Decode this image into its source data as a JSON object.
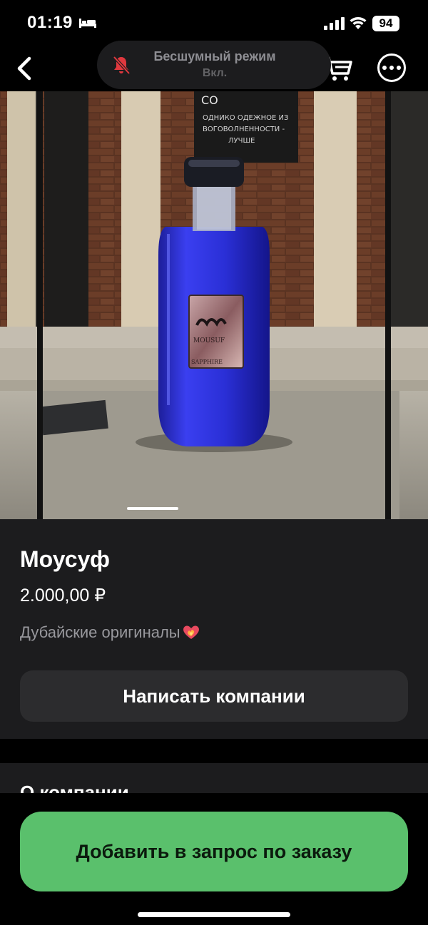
{
  "status_bar": {
    "time": "01:19",
    "battery": "94",
    "icons": [
      "bed-icon",
      "signal-icon",
      "wifi-icon",
      "battery-icon"
    ]
  },
  "nav": {
    "back_icon": "chevron-left-icon",
    "cart_icon": "cart-icon",
    "more_icon": "more-icon"
  },
  "silent_mode": {
    "title": "Бесшумный режим",
    "subtitle": "Вкл.",
    "icon": "bell-slash-icon",
    "icon_color": "#e0383e"
  },
  "product": {
    "name": "Моусуф",
    "price": "2.000,00 ₽",
    "description": "Дубайские оригиналы",
    "description_emoji": "heart-on-fire-icon",
    "image_text": {
      "sign_lines": [
        "СО",
        "ОДНИКО ОДЕЖНОЕ ИЗ",
        "ВОГОВОЛНЕННОСТИ -",
        "ЛУЧШЕ"
      ],
      "label_brand": "MOUSUF",
      "label_sub": "SAPPHIRE"
    },
    "write_button": "Написать компании"
  },
  "about": {
    "title": "О компании"
  },
  "footer": {
    "add_button": "Добавить в запрос по заказу"
  },
  "colors": {
    "background": "#000000",
    "card": "#1c1c1e",
    "button_secondary": "#2c2c2e",
    "accent_green": "#5ac06c"
  }
}
